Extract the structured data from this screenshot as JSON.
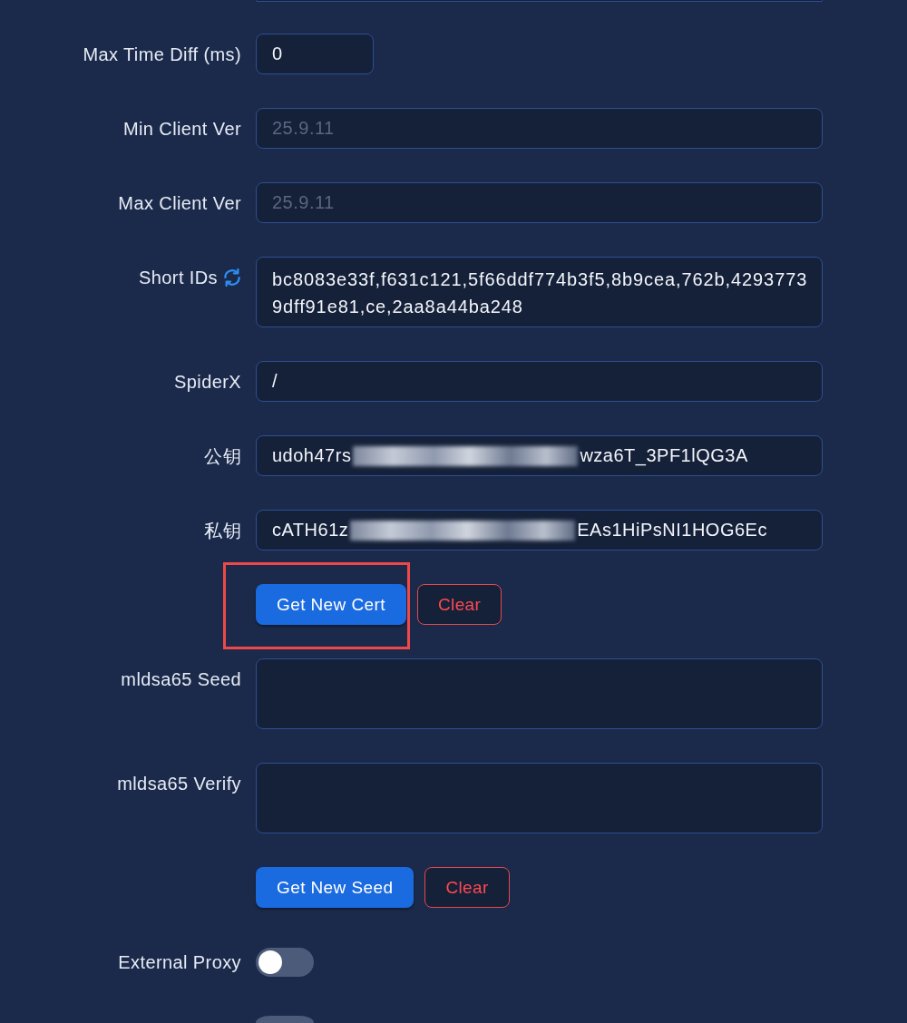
{
  "form": {
    "rows": [
      {
        "kind": "partial-field"
      },
      {
        "kind": "number",
        "label": "Max Time Diff (ms)",
        "value": "0"
      },
      {
        "kind": "text",
        "label": "Min Client Ver",
        "placeholder": "25.9.11"
      },
      {
        "kind": "text",
        "label": "Max Client Ver",
        "placeholder": "25.9.11"
      },
      {
        "kind": "textarea",
        "label": "Short IDs",
        "refresh_icon": true,
        "value": "bc8083e33f,f631c121,5f66ddf774b3f5,8b9cea,762b,42937739dff91e81,ce,2aa8a44ba248"
      },
      {
        "kind": "text",
        "label": "SpiderX",
        "value": "/"
      },
      {
        "kind": "redacted-text",
        "label": "公钥",
        "value": "udoh47rs",
        "redacted": true,
        "value_tail": "wza6T_3PF1lQG3A"
      },
      {
        "kind": "redacted-text",
        "label": "私钥",
        "value": "cATH61z",
        "redacted": true,
        "value_tail": "EAs1HiPsNI1HOG6Ec"
      },
      {
        "kind": "buttons",
        "buttons": [
          {
            "label": "Get New Cert",
            "kind": "primary",
            "highlighted": true
          },
          {
            "label": "Clear",
            "kind": "danger"
          }
        ]
      },
      {
        "kind": "textarea",
        "label": "mldsa65 Seed"
      },
      {
        "kind": "textarea",
        "label": "mldsa65 Verify"
      },
      {
        "kind": "buttons",
        "buttons": [
          {
            "label": "Get New Seed",
            "kind": "primary"
          },
          {
            "label": "Clear",
            "kind": "danger"
          }
        ]
      },
      {
        "kind": "switch",
        "label": "External Proxy",
        "on": false
      },
      {
        "kind": "partial-switch",
        "on": false
      }
    ]
  }
}
